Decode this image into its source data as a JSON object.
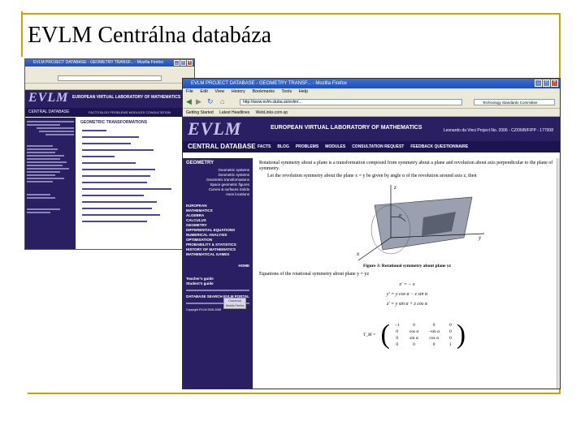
{
  "slide": {
    "title": "EVLM Centrálna databáza"
  },
  "back_window": {
    "title": "EVLM PROJECT DATABASE - GEOMETRY TRANSF... - Mozilla Firefox",
    "logo": "EVLM",
    "banner": "EUROPEAN VIRTUAL LABORATORY OF MATHEMATICS",
    "sitebar": "CENTRAL DATABASE",
    "nav": "FACTS   BLOG   PROBLEMS   MODULES   CONSULTATION",
    "heading": "GEOMETRIC TRANSFORMATIONS",
    "side_items": [
      "Geometry",
      "Geometric transformations",
      "Space geometry",
      "Curves and surfaces",
      "Axes",
      "EUROPE",
      "MATHEMATICS",
      "ALGEBRA",
      "CALCULUS",
      "GEOMETRY",
      "DIFFERENTIAL EQUATIONS",
      "NUMERICAL ANALYSIS",
      "OPTIMISATION",
      "PROBABILITY & STATISTICS",
      "HISTORY",
      "MATHEMATICAL GAMES"
    ]
  },
  "front_window": {
    "title": "EVLM PROJECT DATABASE - GEOMETRY TRANSF... - Mozilla Firefox",
    "menu": [
      "File",
      "Edit",
      "View",
      "History",
      "Bookmarks",
      "Tools",
      "Help"
    ],
    "address": "http://www.evlm.stuba.sk/evlm/...",
    "search": "Technology Standards Committee",
    "bookmarks": [
      "Getting Started",
      "Latest Headlines",
      "WebLinks.com.sp"
    ],
    "logo": "EVLM",
    "banner": "EUROPEAN VIRTUAL LABORATORY OF MATHEMATICS",
    "banner_sub": "Leonardo da Vinci Project No. 2006 - CZ/06/B/F/PP - 177008",
    "sitebar": "CENTRAL DATABASE",
    "nav": [
      "FACTS",
      "BLOG",
      "PROBLEMS",
      "MODULES",
      "CONSULTATION REQUEST",
      "FEEDBACK QUESTIONNAIRE"
    ],
    "side_title": "GEOMETRY",
    "side_sub": [
      "Geometric systems",
      "Geometric systems",
      "Geometric transformations",
      "Space geometric figures",
      "Curves & surfaces Solids",
      "Axes locations"
    ],
    "side_topics": [
      "EUROPEAN",
      "MATHEMATICS",
      "ALGEBRA",
      "CALCULUS",
      "GEOMETRY",
      "DIFFERENTIAL EQUATIONS",
      "NUMERICAL ANALYSIS",
      "OPTIMISATION",
      "PROBABILITY & STATISTICS",
      "HISTORY OF MATHEMATICS",
      "MATHEMATICAL GAMES"
    ],
    "side_home": "HOME",
    "side_links": [
      "Teacher's guide",
      "Student's guide"
    ],
    "side_search": "DATABASE SEARCH EVLM PORTAL",
    "side_copyright": "Copyright EVLM 2006-2008",
    "side_badge": "Download Mozilla Firefox",
    "para1": "Rotational symmetry about a plane is a transformation composed from symmetry about a plane and revolution about axis perpendicular to the plane of symmetry.",
    "para2": "Let the revolution symmetry about the plane x = y be given by angle α of the revolution around axis z, then",
    "figure_caption": "Figure 3: Rotational symmetry about plane yz",
    "para3": "Equations of the rotational symmetry about plane y = yz",
    "eq1": "x' = − x",
    "eq2": "y' = y cos α − z sin α",
    "eq3": "z' = y sin α + z cos α",
    "matrix_label": "T_M =",
    "matrix": [
      [
        "−1",
        "0",
        "0",
        "0"
      ],
      [
        "0",
        "cos α",
        "−sin α",
        "0"
      ],
      [
        "0",
        "sin α",
        "cos α",
        "0"
      ],
      [
        "0",
        "0",
        "0",
        "1"
      ]
    ],
    "fig_labels": [
      "z",
      "y",
      "x",
      "α"
    ]
  }
}
